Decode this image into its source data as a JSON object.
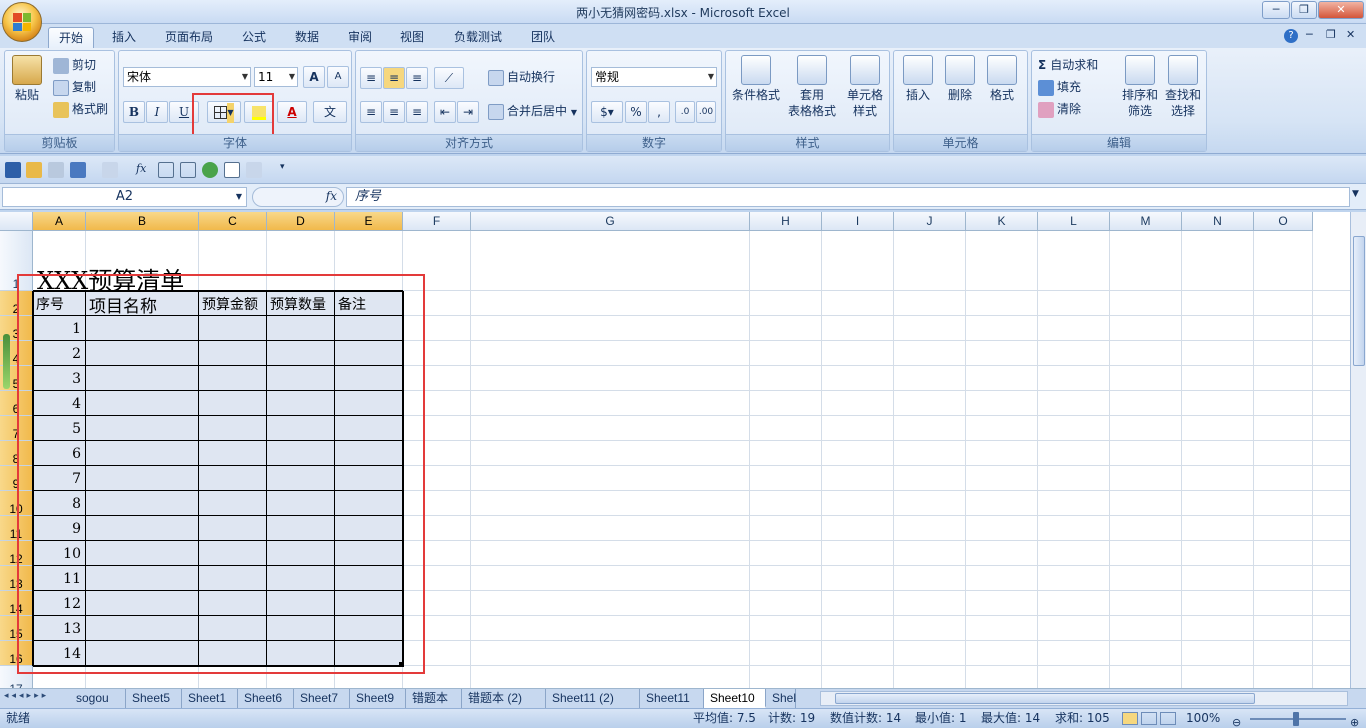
{
  "window": {
    "title": "两小无猜网密码.xlsx - Microsoft Excel",
    "minimize": "─",
    "restore": "❐",
    "close": "✕"
  },
  "ribbon_tabs": [
    "开始",
    "插入",
    "页面布局",
    "公式",
    "数据",
    "审阅",
    "视图",
    "负载测试",
    "团队"
  ],
  "clipboard": {
    "paste": "粘贴",
    "cut": "剪切",
    "copy": "复制",
    "format_painter": "格式刷",
    "label": "剪贴板"
  },
  "font": {
    "name": "宋体",
    "size": "11",
    "grow": "A",
    "shrink": "A",
    "bold": "B",
    "italic": "I",
    "underline": "U",
    "font_color": "A",
    "phonetic": "文",
    "label": "字体"
  },
  "alignment": {
    "wrap": "自动换行",
    "merge": "合并后居中",
    "label": "对齐方式"
  },
  "number": {
    "format": "常规",
    "percent": "%",
    "comma": ",",
    "label": "数字"
  },
  "styles": {
    "conditional_line1": "条件格式",
    "table_line1": "套用",
    "table_line2": "表格格式",
    "cell_line1": "单元格",
    "cell_line2": "样式",
    "label": "样式"
  },
  "cells": {
    "insert": "插入",
    "delete": "删除",
    "format": "格式",
    "label": "单元格"
  },
  "editing": {
    "autosum": "自动求和",
    "fill": "填充",
    "clear": "清除",
    "sort_line1": "排序和",
    "sort_line2": "筛选",
    "find_line1": "查找和",
    "find_line2": "选择",
    "label": "编辑"
  },
  "formula_bar": {
    "name_box": "A2",
    "fx": "fx",
    "value": "序号"
  },
  "columns": [
    "A",
    "B",
    "C",
    "D",
    "E",
    "F",
    "G",
    "H",
    "I",
    "J",
    "K",
    "L",
    "M",
    "N",
    "O"
  ],
  "rows": [
    "1",
    "2",
    "3",
    "4",
    "5",
    "6",
    "7",
    "8",
    "9",
    "10",
    "11",
    "12",
    "13",
    "14",
    "15",
    "16",
    "17"
  ],
  "sheet": {
    "title": "XXX预算清单",
    "headers": [
      "序号",
      "项目名称",
      "预算金额",
      "预算数量",
      "备注"
    ],
    "numbers": [
      "1",
      "2",
      "3",
      "4",
      "5",
      "6",
      "7",
      "8",
      "9",
      "10",
      "11",
      "12",
      "13",
      "14"
    ]
  },
  "sheet_tabs": [
    "sogou",
    "Sheet5",
    "Sheet1",
    "Sheet6",
    "Sheet7",
    "Sheet9",
    "错题本",
    "错题本 (2)",
    "Sheet11 (2)",
    "Sheet11",
    "Sheet10",
    "Shel"
  ],
  "status_bar": {
    "ready": "就绪",
    "average": "平均值: 7.5",
    "count": "计数: 19",
    "numeric_count": "数值计数: 14",
    "min": "最小值: 1",
    "max": "最大值: 14",
    "sum": "求和: 105",
    "zoom": "100%"
  },
  "colors": {
    "highlight": "#e33a3a",
    "selected_header": "#f1b94b",
    "table_fill": "#dfe6f2"
  }
}
